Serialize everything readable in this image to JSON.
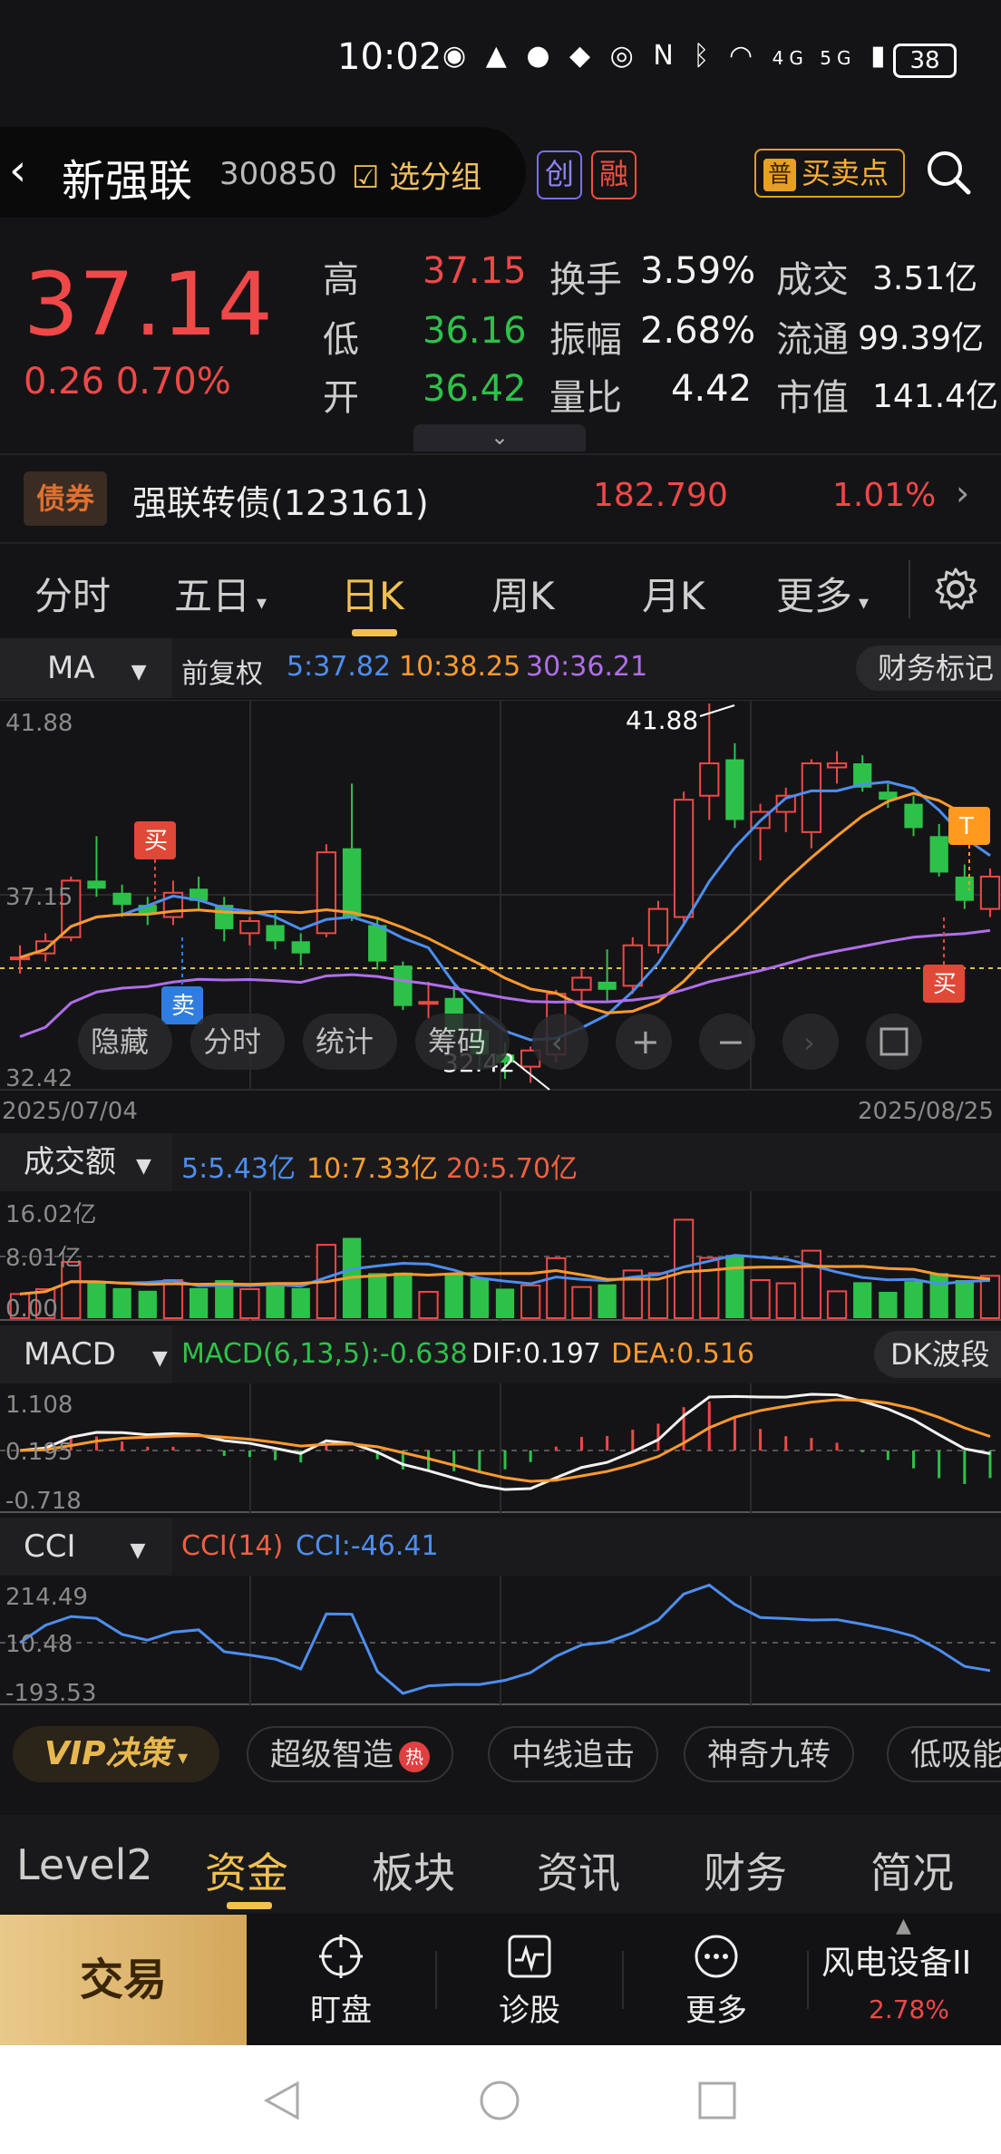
{
  "status_bar": {
    "time": "10:02",
    "network": "4G 5G",
    "battery": "38"
  },
  "header": {
    "stock_name": "新强联",
    "stock_code": "300850",
    "group_btn": "选分组",
    "badge_chuang": "创",
    "badge_rong": "融",
    "buy_sell_icon": "普",
    "buy_sell": "买卖点"
  },
  "quote": {
    "price": "37.14",
    "change": "0.26  0.70%",
    "rows": [
      {
        "l1": "高",
        "v1": "37.15",
        "l2": "换手",
        "v2": "3.59%",
        "l3": "成交",
        "v3": "3.51亿"
      },
      {
        "l1": "低",
        "v1": "36.16",
        "l2": "振幅",
        "v2": "2.68%",
        "l3": "流通",
        "v3": "99.39亿"
      },
      {
        "l1": "开",
        "v1": "36.42",
        "l2": "量比",
        "v2": "4.42",
        "l3": "市值",
        "v3": "141.4亿"
      }
    ]
  },
  "bond": {
    "badge": "债券",
    "name": "强联转债(123161)",
    "price": "182.790",
    "pct": "1.01%"
  },
  "period_tabs": [
    "分时",
    "五日",
    "日K",
    "周K",
    "月K",
    "更多"
  ],
  "active_tab": "日K",
  "ma_bar": {
    "selector": "MA",
    "adjust": "前复权",
    "ma5": "5:37.82",
    "ma10": "10:38.25",
    "ma30": "30:36.21",
    "fin_btn": "财务标记"
  },
  "kline": {
    "y_top": "41.88",
    "y_mid": "37.15",
    "y_bot": "32.42",
    "high_label": "41.88",
    "low_label": "32.42",
    "date_start": "2025/07/04",
    "date_end": "2025/08/25",
    "markers": {
      "buy": "买",
      "sell": "卖",
      "t": "T"
    },
    "overlay_buttons": [
      "隐藏",
      "分时",
      "统计",
      "筹码"
    ]
  },
  "chart_data": {
    "type": "candlestick",
    "ylim": [
      32.42,
      41.88
    ],
    "x": [
      "2025/07/04",
      "2025/08/25"
    ],
    "ohlc": [
      [
        35.6,
        35.9,
        35.2,
        35.6
      ],
      [
        35.7,
        36.2,
        35.5,
        36.0
      ],
      [
        36.1,
        37.6,
        36.0,
        37.5
      ],
      [
        37.5,
        38.6,
        37.1,
        37.3
      ],
      [
        37.2,
        37.4,
        36.6,
        36.9
      ],
      [
        36.9,
        37.1,
        36.4,
        36.7
      ],
      [
        36.6,
        37.5,
        36.4,
        37.2
      ],
      [
        37.3,
        37.6,
        36.8,
        37.0
      ],
      [
        36.9,
        37.1,
        36.0,
        36.3
      ],
      [
        36.2,
        36.6,
        35.9,
        36.5
      ],
      [
        36.4,
        36.7,
        35.8,
        36.0
      ],
      [
        36.0,
        36.2,
        35.4,
        35.7
      ],
      [
        36.2,
        38.4,
        36.1,
        38.2
      ],
      [
        38.3,
        39.9,
        36.5,
        36.6
      ],
      [
        36.4,
        36.6,
        35.3,
        35.5
      ],
      [
        35.4,
        35.5,
        34.3,
        34.4
      ],
      [
        34.5,
        35.0,
        34.1,
        34.5
      ],
      [
        34.6,
        34.9,
        33.6,
        33.8
      ],
      [
        33.8,
        34.2,
        32.9,
        33.2
      ],
      [
        33.2,
        33.5,
        32.6,
        33.0
      ],
      [
        32.9,
        33.4,
        32.5,
        33.3
      ],
      [
        33.2,
        34.8,
        33.0,
        34.7
      ],
      [
        34.8,
        35.3,
        34.4,
        35.1
      ],
      [
        35.0,
        35.8,
        34.5,
        34.8
      ],
      [
        34.9,
        36.1,
        34.7,
        35.9
      ],
      [
        35.9,
        37.0,
        35.7,
        36.8
      ],
      [
        36.6,
        39.7,
        36.4,
        39.5
      ],
      [
        39.6,
        41.88,
        39.0,
        40.4
      ],
      [
        40.5,
        40.9,
        38.8,
        39.0
      ],
      [
        38.8,
        39.4,
        38.0,
        39.2
      ],
      [
        39.2,
        39.8,
        38.7,
        39.6
      ],
      [
        38.7,
        40.5,
        38.3,
        40.4
      ],
      [
        40.3,
        40.7,
        39.9,
        40.4
      ],
      [
        40.4,
        40.6,
        39.7,
        39.8
      ],
      [
        39.7,
        39.9,
        39.3,
        39.5
      ],
      [
        39.4,
        39.6,
        38.6,
        38.8
      ],
      [
        38.6,
        38.9,
        37.6,
        37.7
      ],
      [
        37.6,
        37.9,
        36.8,
        37.0
      ],
      [
        36.8,
        37.8,
        36.6,
        37.6
      ]
    ],
    "volume": {
      "labels": [
        "16.02亿",
        "8.01亿",
        "0.00"
      ],
      "ma5": "5:5.43亿",
      "ma10": "10:7.33亿",
      "ma20": "20:5.70亿"
    },
    "macd": {
      "labels": [
        "1.108",
        "0.195",
        "-0.718"
      ],
      "title": "MACD(6,13,5):-0.638",
      "dif": "DIF:0.197",
      "dea": "DEA:0.516"
    },
    "cci": {
      "labels": [
        "214.49",
        "10.48",
        "-193.53"
      ],
      "title": "CCI(14)",
      "value": "CCI:-46.41"
    }
  },
  "sub_bars": {
    "volume_selector": "成交额",
    "macd_selector": "MACD",
    "macd_btn": "DK波段",
    "cci_selector": "CCI"
  },
  "vip_bar": {
    "vip": "VIP决策",
    "chips": [
      "超级智造",
      "中线追击",
      "神奇九转",
      "低吸能"
    ],
    "hot": "热"
  },
  "bottom_tabs": [
    "Level2",
    "资金",
    "板块",
    "资讯",
    "财务",
    "简况"
  ],
  "bottom_active": "资金",
  "actions": {
    "trade": "交易",
    "watch": "盯盘",
    "diagnose": "诊股",
    "more": "更多",
    "sector": "风电设备II",
    "sector_pct": "2.78%"
  },
  "colors": {
    "up": "#f04848",
    "down": "#2ec14a",
    "accent": "#f0c050"
  }
}
